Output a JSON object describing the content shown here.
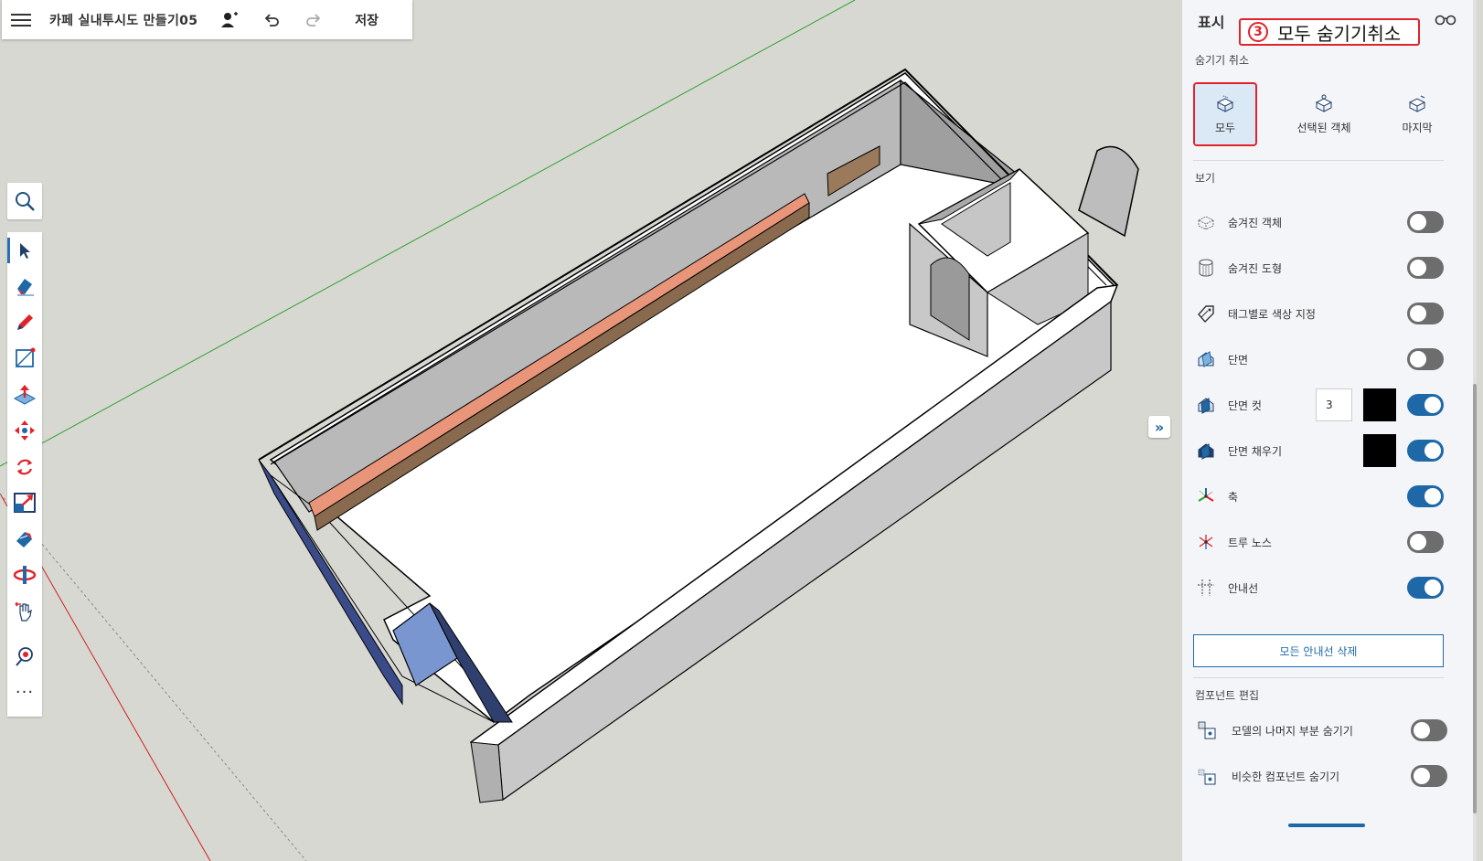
{
  "topbar": {
    "title": "카페 실내투시도 만들기05",
    "save_label": "저장"
  },
  "toolbar": {
    "tools": [
      "select",
      "eraser",
      "pencil",
      "rectangle",
      "push-pull",
      "move",
      "rotate",
      "scale",
      "paint-bucket",
      "orbit",
      "pan",
      "position-camera",
      "more"
    ],
    "more_label": "···"
  },
  "panel": {
    "title": "표시",
    "callout": {
      "number": "3",
      "text": "모두 숨기기취소"
    },
    "unhide_section": "숨기기 취소",
    "unhide_options": [
      "모두",
      "선택된 객체",
      "마지막"
    ],
    "unhide_selected": "모두",
    "view_section": "보기",
    "view_rows": [
      {
        "label": "숨겨진 객체",
        "on": false
      },
      {
        "label": "숨겨진 도형",
        "on": false
      },
      {
        "label": "태그별로 색상 지정",
        "on": false
      },
      {
        "label": "단면",
        "on": false
      },
      {
        "label": "단면 컷",
        "on": true,
        "value": "3",
        "color": "#000000"
      },
      {
        "label": "단면 채우기",
        "on": true,
        "color": "#000000"
      },
      {
        "label": "축",
        "on": true
      },
      {
        "label": "트루 노스",
        "on": false
      },
      {
        "label": "안내선",
        "on": true
      }
    ],
    "delete_guides_label": "모든 안내선 삭제",
    "component_section": "컴포넌트 편집",
    "component_rows": [
      {
        "label": "모델의 나머지 부분 숨기기",
        "on": false
      },
      {
        "label": "비슷한 컴포넌트 숨기기",
        "on": false
      }
    ]
  },
  "colors": {
    "accent": "#1f68a8",
    "highlight": "#e0232b",
    "canvas": "#d7d8d2"
  }
}
